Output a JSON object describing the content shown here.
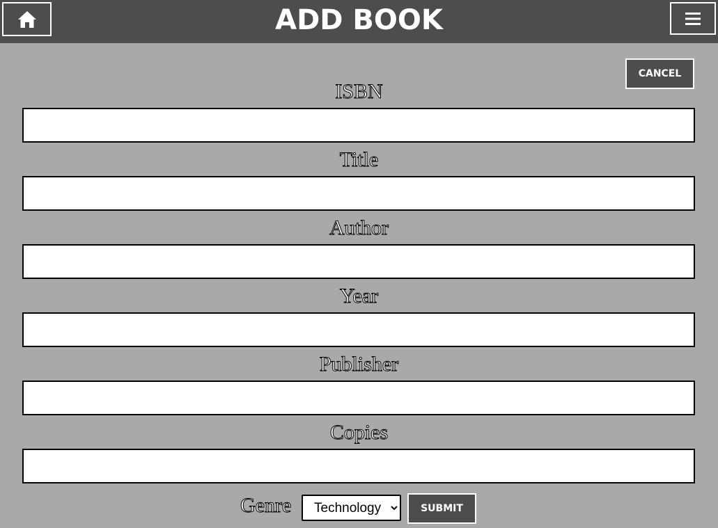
{
  "header": {
    "title": "ADD BOOK",
    "home_icon": "home-icon",
    "menu_icon": "hamburger-menu-icon"
  },
  "actions": {
    "cancel_label": "CANCEL",
    "submit_label": "SUBMIT"
  },
  "form": {
    "fields": [
      {
        "label": "ISBN",
        "value": "",
        "placeholder": ""
      },
      {
        "label": "Title",
        "value": "",
        "placeholder": ""
      },
      {
        "label": "Author",
        "value": "",
        "placeholder": ""
      },
      {
        "label": "Year",
        "value": "",
        "placeholder": ""
      },
      {
        "label": "Publisher",
        "value": "",
        "placeholder": ""
      },
      {
        "label": "Copies",
        "value": "",
        "placeholder": ""
      }
    ],
    "genre": {
      "label": "Genre",
      "selected": "Technology"
    }
  },
  "colors": {
    "background": "#a9a9a9",
    "header": "#4d4d4d",
    "button": "#4d4d4d",
    "button_border": "#ffffff",
    "input_border": "#000000"
  }
}
